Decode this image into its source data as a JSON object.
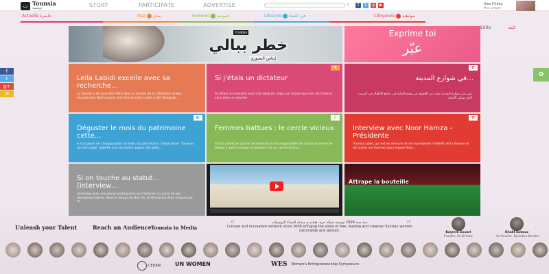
{
  "topbar": {
    "logo_main": "Tounsia",
    "logo_sub": "Tunisia Women",
    "logo_ar": "تونسية",
    "nav": [
      "STORY",
      "PARTICIPATE",
      "ADVERTISE"
    ],
    "search_placeholder": "",
    "user_name": "Ines Chliou",
    "user_sub": "Mon compte"
  },
  "categories": [
    {
      "label": "Actuelle",
      "ar": "حاضرة",
      "color": "#d63a6b"
    },
    {
      "label": "Star",
      "ar": "ستار",
      "color": "#f08a2c"
    },
    {
      "label": "Femmes",
      "ar": "فموسو",
      "color": "#87be4e"
    },
    {
      "label": "Lifestyle",
      "ar": "في الحياة",
      "color": "#46a8d9"
    },
    {
      "label": "Citoyenne",
      "ar": "مواطنة",
      "color": "#e53a32"
    }
  ],
  "edito": {
    "label": "Edito",
    "ar": "كلمة"
  },
  "hero": {
    "brand": "TOUNSIA",
    "title_ar": "خطر ببالي",
    "sub_ar": "إيناس النصوري"
  },
  "exprime": {
    "title": "Exprime toi",
    "title_ar": "عبّر"
  },
  "tiles": [
    {
      "title": "Leila Labidi excelle avec sa recherche…",
      "text": "La Tunisie a de quoi être fière dans le monde de la littérature arabo-musulmane. Notre jeune chercheuse Leila Labidi a été désignée…",
      "color": "#e57a55"
    },
    {
      "title": "Si j'étais un dictateur",
      "text": "Si j'étais un monstre nourri de sang Un voyou un moins que rien Un homme sans âme un vaurien",
      "color": "#d94a77"
    },
    {
      "title": "في شوارع المدينة…",
      "text": "عيني في شوارع المدينة تبحث عن الحقيقة في وجوه المارة في ملامح الأطفال في الصمت الذي يسكن الأمكنة",
      "color": "#c93a62"
    },
    {
      "title": "Déguster le mois du patrimoine cette…",
      "text": "A l'occasion de l'inauguration du mois du patrimoine, l'association \"Saveurs de mon pays\" planifie une rencontre autour des plats…",
      "color": "#3fa2d4"
    },
    {
      "title": "Femmes battues : le cercle vicieux",
      "text": "Il faut admettre que la femme battue est responsable de ce qui lui arrive de temps à autre lorsque la violence est un cercle vicieux…",
      "color": "#87b958"
    },
    {
      "title": "Interview avec Noor Hamza - Présidente",
      "text": "Tounsia Libre, qui est en mesure de ne représenter l'intérêt de la femme et de toutes les femmes pour lequel Noor…",
      "color": "#e23b31"
    },
    {
      "title": "Si on touche au statut… (interview…",
      "text": "Interview avec une jeune participante aux femmes un autre de nos discussions libres. Dans le temps de Ben Ali, le féminisme était imposé par la…",
      "color": "#9a9a9a"
    }
  ],
  "game": {
    "title": "Attrape la bouteille"
  },
  "partners": [
    "Unleash your Talent",
    "Reach an Audience",
    "Tounsia in Media"
  ],
  "quote": {
    "ar": "منذ سنة 2008 تونسية شبكة حرة، قيادية و مبدعة للنساء التونسيات",
    "en": "Cultural and innovative network since 2008 bringing the voice of free, leading and creative Tunisian women nationwide and abroad."
  },
  "founders": [
    {
      "name": "Bayrem Zouari",
      "role": "Founder, Art Director"
    },
    {
      "name": "Khalil Sakouz",
      "role": "Co-Founder, Executive Director"
    }
  ],
  "sponsors": [
    "CEDAW",
    "UN WOMEN",
    "WES",
    "Women's Entrepreneurship Symposium"
  ],
  "share": [
    {
      "icon": "f",
      "color": "#3b5998"
    },
    {
      "icon": "t",
      "color": "#55acee"
    },
    {
      "icon": "g+",
      "color": "#dd4b39"
    },
    {
      "icon": "✉",
      "color": "#f0b828"
    }
  ],
  "share_right_icon": "✿"
}
